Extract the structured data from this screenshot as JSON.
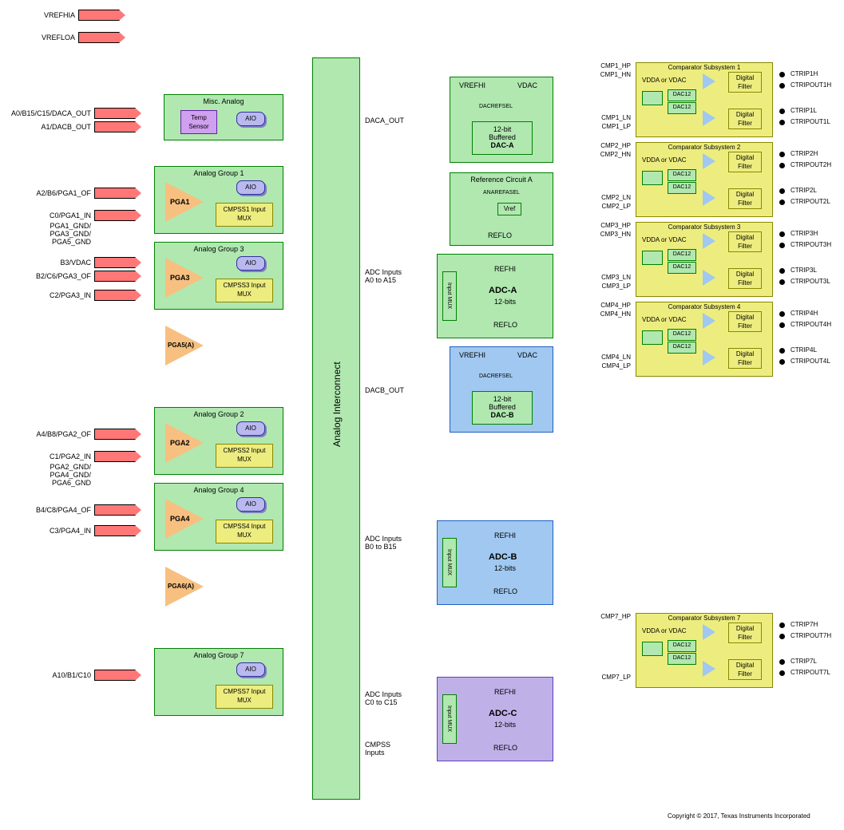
{
  "title_note": "Copyright © 2017, Texas Instruments Incorporated",
  "top_pins": {
    "vrefhia": "VREFHIA",
    "vrefloa": "VREFLOA"
  },
  "left_pins": {
    "a0": "A0/B15/C15/DACA_OUT",
    "a1": "A1/DACB_OUT",
    "a2": "A2/B6/PGA1_OF",
    "c0": "C0/PGA1_IN",
    "pga1g": "PGA1_GND/\nPGA3_GND/\nPGA5_GND",
    "b3": "B3/VDAC",
    "b2": "B2/C6/PGA3_OF",
    "c2": "C2/PGA3_IN",
    "a4": "A4/B8/PGA2_OF",
    "c1": "C1/PGA2_IN",
    "pga2g": "PGA2_GND/\nPGA4_GND/\nPGA6_GND",
    "b4": "B4/C8/PGA4_OF",
    "c3": "C3/PGA4_IN",
    "a10": "A10/B1/C10"
  },
  "misc": {
    "title": "Misc. Analog",
    "temp": "Temp\nSensor",
    "aio": "AIO"
  },
  "groups": {
    "g1": "Analog Group 1",
    "g2": "Analog Group 2",
    "g3": "Analog Group 3",
    "g4": "Analog Group 4",
    "g7": "Analog Group 7"
  },
  "pga": {
    "p1": "PGA1",
    "p2": "PGA2",
    "p3": "PGA3",
    "p4": "PGA4",
    "p5": "PGA5(A)",
    "p6": "PGA6(A)"
  },
  "cmpss_mux": {
    "m1": "CMPSS1\nInput MUX",
    "m2": "CMPSS2\nInput MUX",
    "m3": "CMPSS3\nInput MUX",
    "m4": "CMPSS4\nInput MUX",
    "m7": "CMPSS7\nInput MUX"
  },
  "interconnect": "Analog Interconnect",
  "mid_labels": {
    "daca": "DACA_OUT",
    "dacb": "DACB_OUT",
    "adcA": "ADC Inputs\nA0 to A15",
    "adcB": "ADC Inputs\nB0 to B15",
    "adcC": "ADC Inputs\nC0 to C15",
    "cmpss": "CMPSS\nInputs"
  },
  "dac": {
    "vrefhi": "VREFHI",
    "vdac": "VDAC",
    "sel": "DACREFSEL",
    "buf12": "12-bit\nBuffered",
    "dacA": "DAC-A",
    "dacB": "DAC-B"
  },
  "ref": {
    "title": "Reference Circuit A",
    "ana": "ANAREFASEL",
    "vref": "Vref",
    "reflo": "REFLO"
  },
  "adc": {
    "refhi": "REFHI",
    "reflo": "REFLO",
    "imux": "Input\nMUX",
    "a": "ADC-A",
    "b": "ADC-B",
    "c": "ADC-C",
    "bits": "12-bits"
  },
  "cmp": {
    "sub1": "Comparator Subsystem 1",
    "sub2": "Comparator Subsystem 2",
    "sub3": "Comparator Subsystem 3",
    "sub4": "Comparator Subsystem 4",
    "sub7": "Comparator Subsystem 7",
    "vdda": "VDDA or VDAC",
    "dac12": "DAC12",
    "filter": "Digital\nFilter"
  },
  "cmp_pins": {
    "1": {
      "hp": "CMP1_HP",
      "hn": "CMP1_HN",
      "ln": "CMP1_LN",
      "lp": "CMP1_LP"
    },
    "2": {
      "hp": "CMP2_HP",
      "hn": "CMP2_HN",
      "ln": "CMP2_LN",
      "lp": "CMP2_LP"
    },
    "3": {
      "hp": "CMP3_HP",
      "hn": "CMP3_HN",
      "ln": "CMP3_LN",
      "lp": "CMP3_LP"
    },
    "4": {
      "hp": "CMP4_HP",
      "hn": "CMP4_HN",
      "ln": "CMP4_LN",
      "lp": "CMP4_LP"
    },
    "7": {
      "hp": "CMP7_HP",
      "lp": "CMP7_LP"
    }
  },
  "cmp_out": {
    "1": {
      "h": "CTRIP1H",
      "oh": "CTRIPOUT1H",
      "l": "CTRIP1L",
      "ol": "CTRIPOUT1L"
    },
    "2": {
      "h": "CTRIP2H",
      "oh": "CTRIPOUT2H",
      "l": "CTRIP2L",
      "ol": "CTRIPOUT2L"
    },
    "3": {
      "h": "CTRIP3H",
      "oh": "CTRIPOUT3H",
      "l": "CTRIP3L",
      "ol": "CTRIPOUT3L"
    },
    "4": {
      "h": "CTRIP4H",
      "oh": "CTRIPOUT4H",
      "l": "CTRIP4L",
      "ol": "CTRIPOUT4L"
    },
    "7": {
      "h": "CTRIP7H",
      "oh": "CTRIPOUT7H",
      "l": "CTRIP7L",
      "ol": "CTRIPOUT7L"
    }
  }
}
